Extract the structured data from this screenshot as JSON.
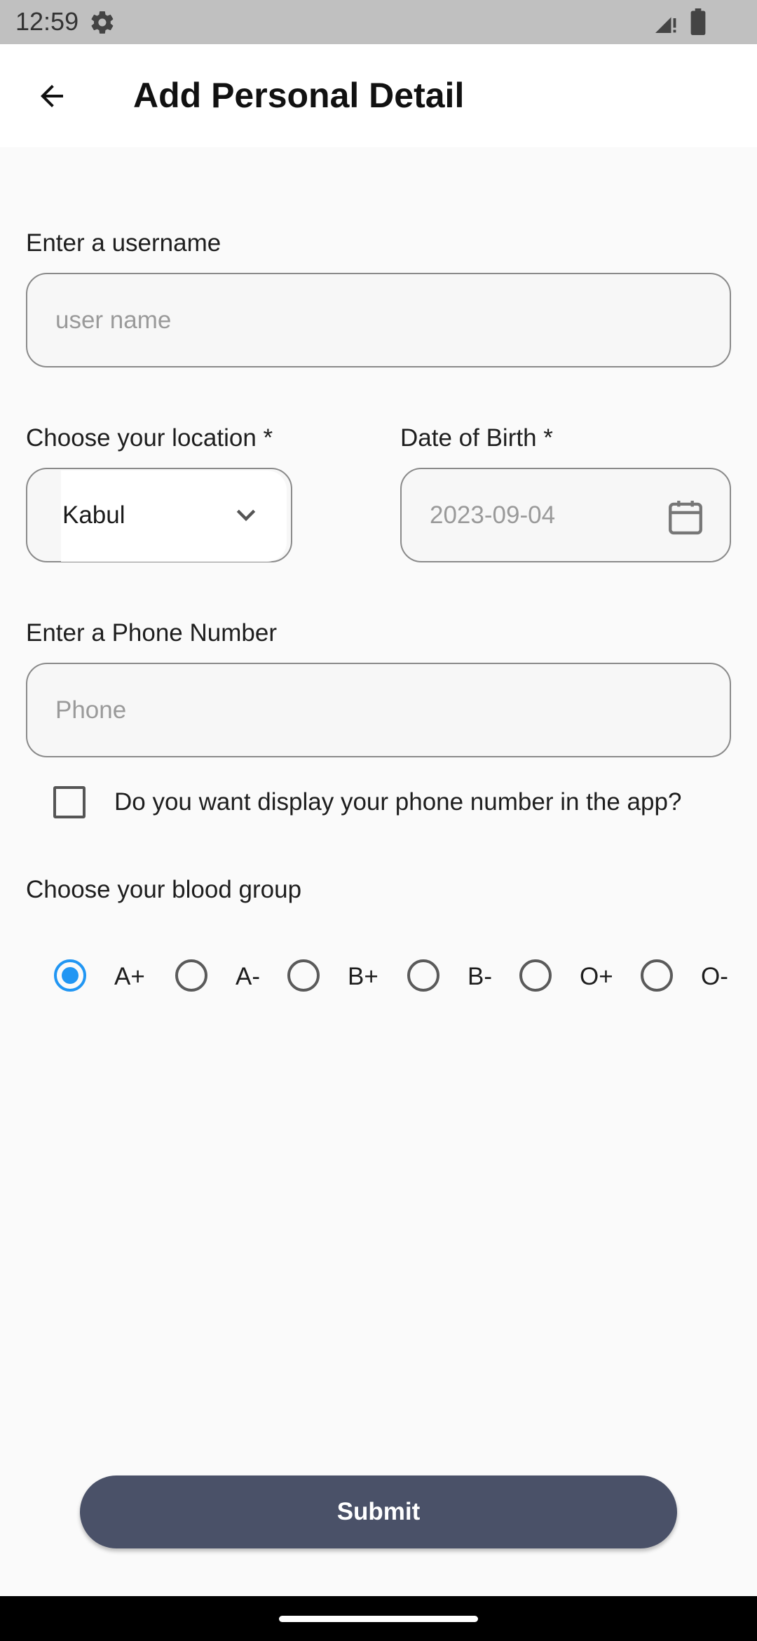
{
  "status_bar": {
    "time": "12:59",
    "icons": [
      "settings-gear-icon",
      "signal-icon",
      "battery-icon"
    ]
  },
  "app_bar": {
    "back_icon": "arrow-left-icon",
    "title": "Add Personal Detail"
  },
  "form": {
    "username": {
      "label": "Enter a username",
      "placeholder": "user name",
      "value": ""
    },
    "location": {
      "label": "Choose your location *",
      "selected": "Kabul",
      "icon": "chevron-down-icon"
    },
    "dob": {
      "label": "Date of Birth *",
      "placeholder": "2023-09-04",
      "icon": "calendar-icon"
    },
    "phone": {
      "label": "Enter a Phone Number",
      "placeholder": "Phone",
      "value": ""
    },
    "display_phone": {
      "label": "Do you want display your phone number in the app?",
      "checked": false
    },
    "blood_group": {
      "label": "Choose your blood group",
      "options": [
        "A+",
        "A-",
        "B+",
        "B-",
        "O+",
        "O-"
      ],
      "selected": "A+"
    },
    "submit_label": "Submit"
  },
  "colors": {
    "accent": "#2196f3",
    "button": "#4a5168",
    "background": "#fafafa",
    "status_bar": "#c0c0c0"
  }
}
